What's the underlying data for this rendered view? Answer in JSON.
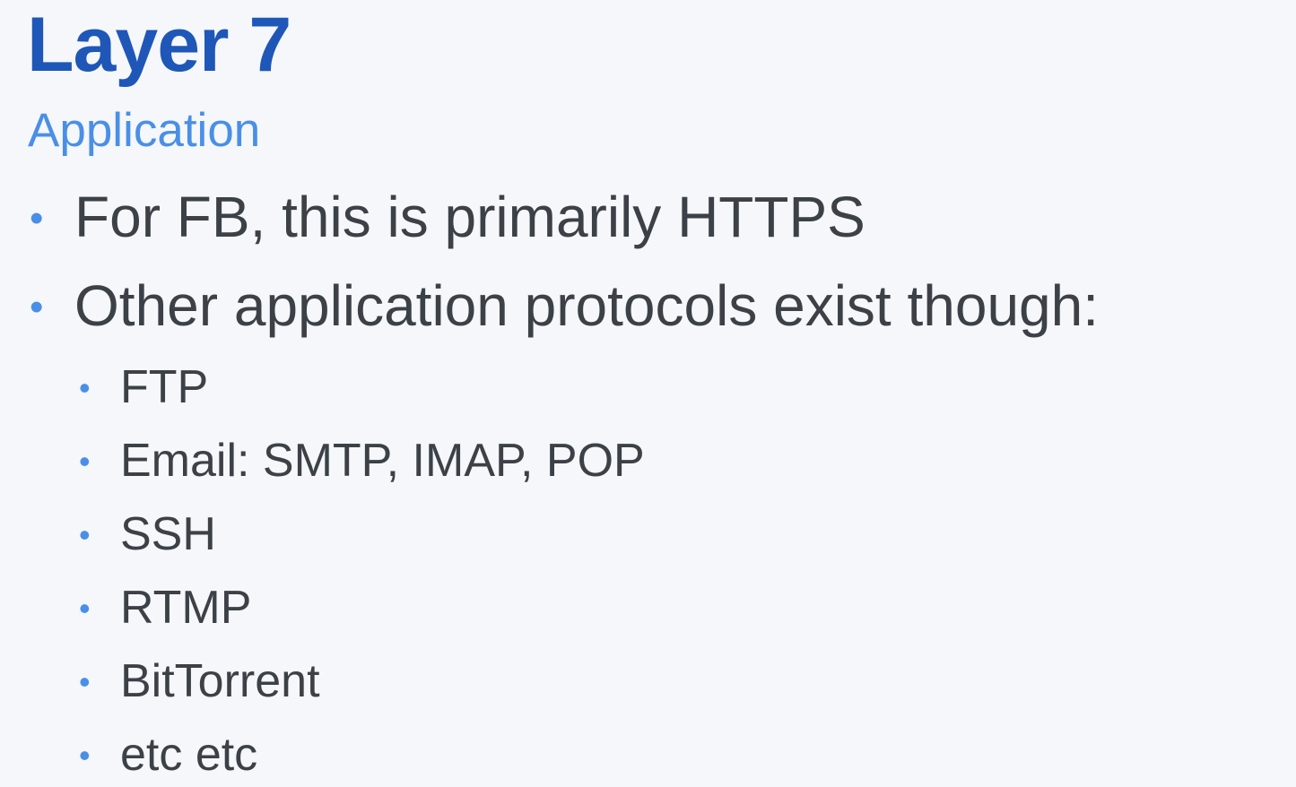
{
  "slide": {
    "title": "Layer 7",
    "subtitle": "Application",
    "bullet_glyph": "•",
    "bullets": [
      "For FB, this is primarily HTTPS",
      "Other application protocols exist though:"
    ],
    "sub_bullets": [
      "FTP",
      "Email: SMTP, IMAP, POP",
      "SSH",
      "RTMP",
      "BitTorrent",
      "etc etc"
    ]
  },
  "colors": {
    "title": "#1f57b8",
    "subtitle": "#4a8fe7",
    "bullet": "#4a8fe7",
    "text": "#3c4148",
    "background": "#f5f7fa"
  }
}
